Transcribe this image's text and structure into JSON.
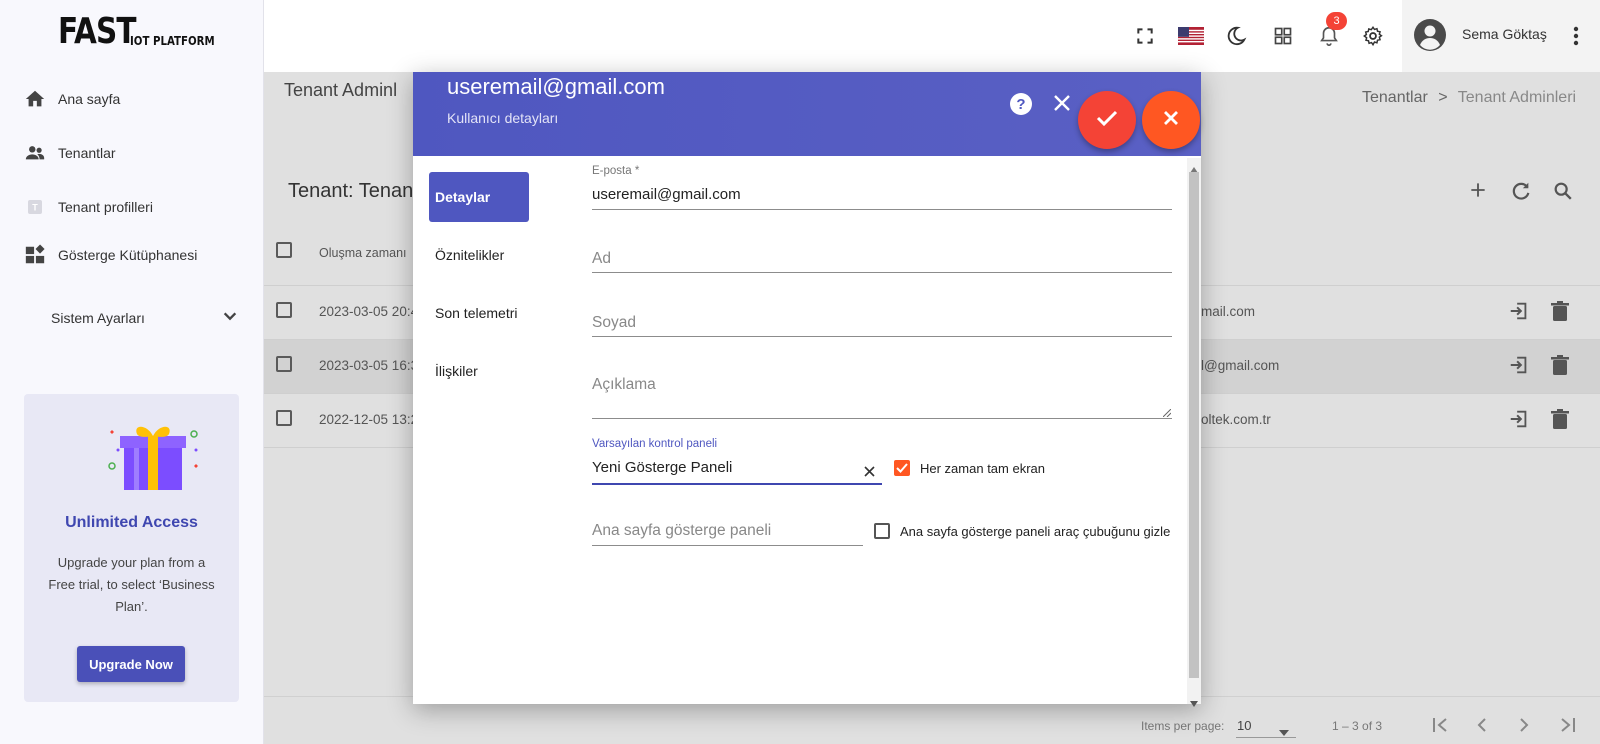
{
  "app": {
    "logo_main": "FAST",
    "logo_sub": "IOT PLATFORM"
  },
  "sidebar": {
    "items": [
      {
        "label": "Ana sayfa",
        "icon": "home-icon"
      },
      {
        "label": "Tenantlar",
        "icon": "people-icon"
      },
      {
        "label": "Tenant profilleri",
        "icon": "tenant-profile-icon"
      },
      {
        "label": "Gösterge Kütüphanesi",
        "icon": "dashboard-library-icon"
      }
    ],
    "system_settings": "Sistem Ayarları",
    "promo": {
      "title": "Unlimited Access",
      "text": "Upgrade your plan from a Free trial, to select ‘Business Plan’.",
      "button": "Upgrade Now"
    }
  },
  "topbar": {
    "notification_count": "3",
    "user_name": "Sema Göktaş"
  },
  "page": {
    "title": "Tenant Adminl",
    "breadcrumb": [
      "Tenantlar",
      ">",
      "Tenant Adminleri"
    ],
    "tenant_title": "Tenant: Tenan",
    "table": {
      "header_created": "Oluşma zamanı",
      "rows": [
        {
          "created": "2023-03-05 20:4",
          "email": "mail.com"
        },
        {
          "created": "2023-03-05 16:3",
          "email": "l@gmail.com"
        },
        {
          "created": "2022-12-05 13:2",
          "email": "oltek.com.tr"
        }
      ]
    },
    "pager": {
      "items_per_page_label": "Items per page:",
      "items_per_page_value": "10",
      "range": "1 – 3 of 3"
    }
  },
  "dialog": {
    "title": "useremail@gmail.com",
    "subtitle": "Kullanıcı detayları",
    "tabs": [
      "Detaylar",
      "Öznitelikler",
      "Son telemetri",
      "İlişkiler"
    ],
    "fields": {
      "email_label": "E-posta *",
      "email_value": "useremail@gmail.com",
      "first_name_placeholder": "Ad",
      "last_name_placeholder": "Soyad",
      "description_placeholder": "Açıklama",
      "default_dashboard_label": "Varsayılan kontrol paneli",
      "default_dashboard_value": "Yeni Gösterge Paneli",
      "always_fullscreen_label": "Her zaman tam ekran",
      "home_dashboard_placeholder": "Ana sayfa gösterge paneli",
      "hide_toolbar_label": "Ana sayfa gösterge paneli araç çubuğunu gizle"
    }
  },
  "colors": {
    "primary": "#4f57c0",
    "accent": "#ff5722",
    "danger": "#f44336",
    "badge": "#f44336"
  }
}
